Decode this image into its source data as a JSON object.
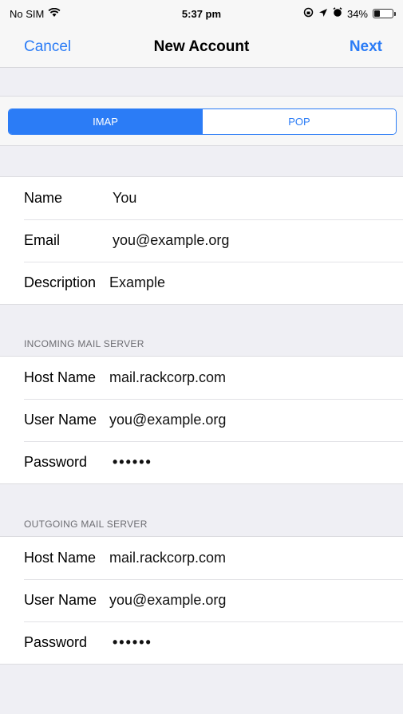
{
  "status_bar": {
    "carrier": "No SIM",
    "time": "5:37 pm",
    "battery_percent": "34%",
    "battery_level": 0.34,
    "icons": [
      "wifi-icon",
      "location-icon",
      "alarm-icon",
      "lock-rotation-icon"
    ]
  },
  "nav": {
    "cancel_label": "Cancel",
    "title": "New Account",
    "next_label": "Next"
  },
  "account_type": {
    "options": [
      "IMAP",
      "POP"
    ],
    "selected": "IMAP"
  },
  "account": {
    "name_label": "Name",
    "name_value": "You",
    "email_label": "Email",
    "email_value": "you@example.org",
    "description_label": "Description",
    "description_value": "Example"
  },
  "incoming": {
    "header": "INCOMING MAIL SERVER",
    "host_label": "Host Name",
    "host_value": "mail.rackcorp.com",
    "user_label": "User Name",
    "user_value": "you@example.org",
    "password_label": "Password",
    "password_value": "••••••"
  },
  "outgoing": {
    "header": "OUTGOING MAIL SERVER",
    "host_label": "Host Name",
    "host_value": "mail.rackcorp.com",
    "user_label": "User Name",
    "user_value": "you@example.org",
    "password_label": "Password",
    "password_value": "••••••"
  },
  "colors": {
    "accent": "#2b7cf6",
    "background": "#efeff4",
    "section_header": "#6d6d72"
  }
}
